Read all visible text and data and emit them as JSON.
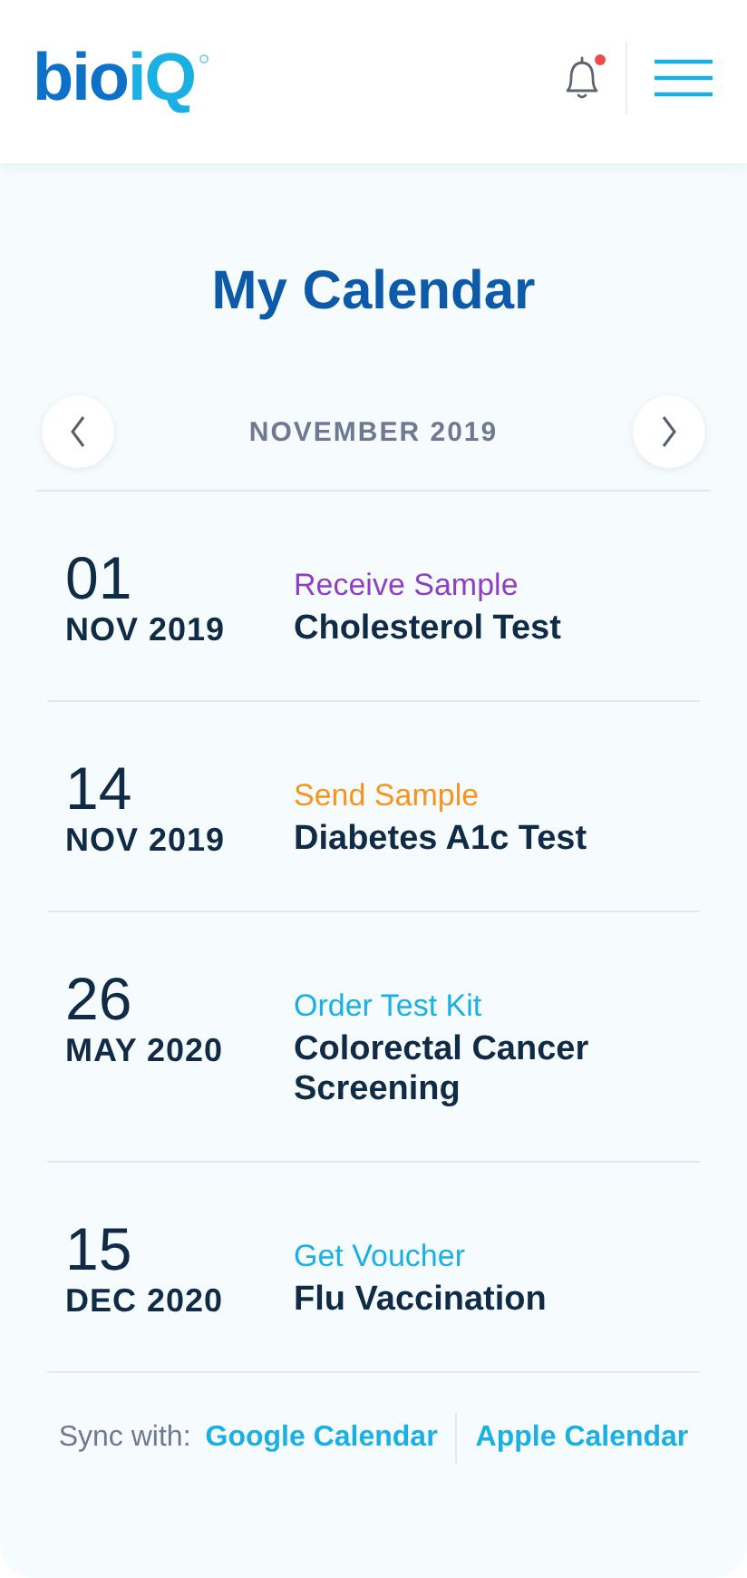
{
  "header": {
    "logo": {
      "first": "bio",
      "second": "iQ"
    },
    "notification": {
      "unread": true
    }
  },
  "title": "My Calendar",
  "month_nav": {
    "label": "NOVEMBER 2019"
  },
  "events": [
    {
      "day": "01",
      "month_year": "NOV 2019",
      "type": "Receive Sample",
      "color": "#8e3fc4",
      "name": "Cholesterol Test"
    },
    {
      "day": "14",
      "month_year": "NOV 2019",
      "type": "Send Sample",
      "color": "#f7941d",
      "name": "Diabetes A1c Test"
    },
    {
      "day": "26",
      "month_year": "MAY 2020",
      "type": "Order Test Kit",
      "color": "#1ab0e4",
      "name": "Colorectal Cancer Screening"
    },
    {
      "day": "15",
      "month_year": "DEC 2020",
      "type": "Get Voucher",
      "color": "#1ab0e4",
      "name": "Flu Vaccination"
    }
  ],
  "sync": {
    "label": "Sync with:",
    "links": [
      "Google Calendar",
      "Apple Calendar"
    ]
  }
}
